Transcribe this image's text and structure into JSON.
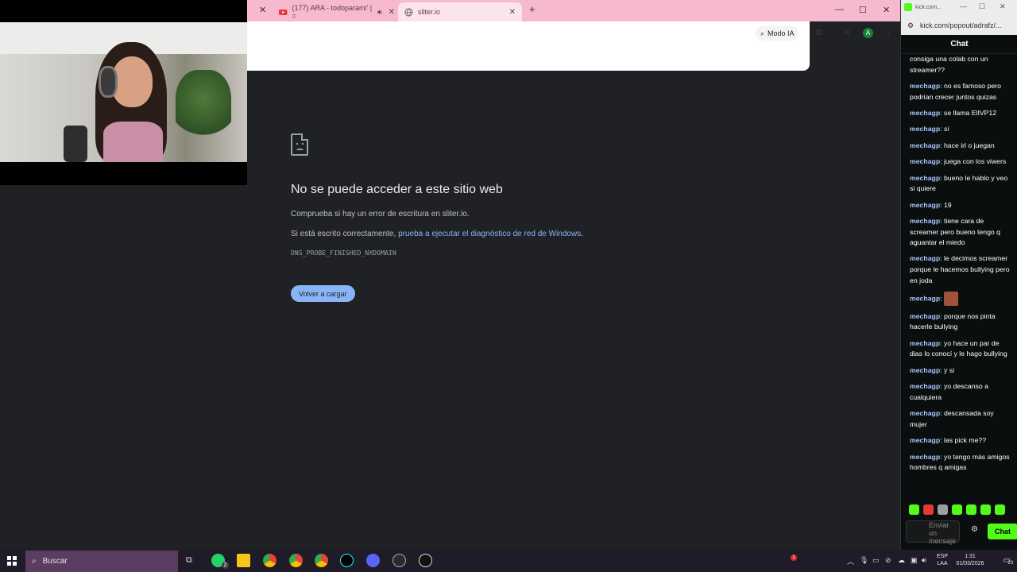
{
  "browser": {
    "tabs": [
      {
        "title": "(177) ARA - todoparami' | =",
        "active": false
      },
      {
        "title": "sliter.io",
        "active": true
      }
    ],
    "new_tab": "+",
    "modo_ia": "Modo IA",
    "avatar_letter": "A"
  },
  "error_page": {
    "title": "No se puede acceder a este sitio web",
    "line1": "Comprueba si hay un error de escritura en sliter.io.",
    "line2_prefix": "Si está escrito correctamente, ",
    "line2_link": "prueba a ejecutar el diagnóstico de red de Windows",
    "line2_suffix": ".",
    "code": "DNS_PROBE_FINISHED_NXDOMAIN",
    "reload_label": "Volver a cargar"
  },
  "kick": {
    "window_title": "kick.com...",
    "address": "kick.com/popout/adrafz/...",
    "header": "Chat",
    "messages": [
      {
        "user": "",
        "text": "consiga una colab con un streamer??"
      },
      {
        "user": "mechagp",
        "text": "no es famoso pero podrían crecer juntos quizas"
      },
      {
        "user": "mechagp",
        "text": "se llama ElIVP12"
      },
      {
        "user": "mechagp",
        "text": "si"
      },
      {
        "user": "mechagp",
        "text": "hace irl o juegan"
      },
      {
        "user": "mechagp",
        "text": "juega con los viwers"
      },
      {
        "user": "mechagp",
        "text": "bueno le hablo y veo si quiere"
      },
      {
        "user": "mechagp",
        "text": "19"
      },
      {
        "user": "mechagp",
        "text": "tiene cara de screamer pero bueno tengo q aguantar el miedo"
      },
      {
        "user": "mechagp",
        "text": "le decimos screamer porque le hacemos bullying pero en joda"
      },
      {
        "user": "mechagp",
        "text": "",
        "emote": true
      },
      {
        "user": "mechagp",
        "text": "porque nos pinta hacerle bullying"
      },
      {
        "user": "mechagp",
        "text": "yo hace un par de dias lo conocí y le hago bullying"
      },
      {
        "user": "mechagp",
        "text": "y si"
      },
      {
        "user": "mechagp",
        "text": "yo descanso a cualquiera"
      },
      {
        "user": "mechagp",
        "text": "descansada soy mujer"
      },
      {
        "user": "mechagp",
        "text": "las pick me??"
      },
      {
        "user": "mechagp",
        "text": "yo tengo más amigos hombres q amigas"
      }
    ],
    "input_placeholder": "Enviar un mensaje",
    "send_label": "Chat",
    "accent": "#53fc18"
  },
  "taskbar": {
    "search_placeholder": "Buscar",
    "whatsapp_badge": "2",
    "notification_badge": "1",
    "lang_line1": "ESP",
    "lang_line2": "LAA",
    "time": "1:31",
    "date": "01/03/2026",
    "notif_count": "23"
  }
}
